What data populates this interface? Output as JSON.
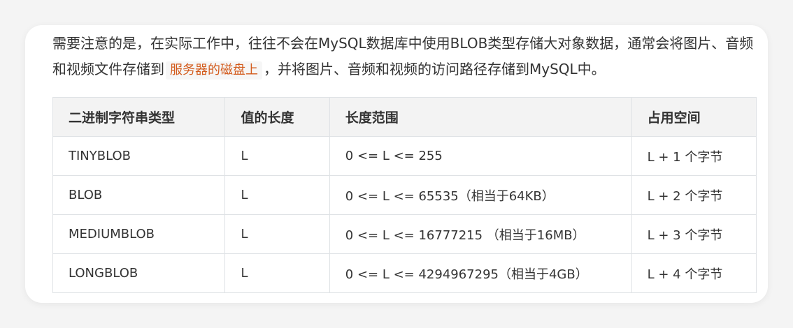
{
  "note": {
    "text_before": "需要注意的是，在实际工作中，往往不会在MySQL数据库中使用BLOB类型存储大对象数据，通常会将图片、音频和视频文件存储到",
    "highlight": "服务器的磁盘上",
    "text_after": "，并将图片、音频和视频的访问路径存储到MySQL中。"
  },
  "table": {
    "headers": [
      "二进制字符串类型",
      "值的长度",
      "长度范围",
      "占用空间"
    ],
    "rows": [
      [
        "TINYBLOB",
        "L",
        "0 <= L <= 255",
        "L + 1 个字节"
      ],
      [
        "BLOB",
        "L",
        "0 <= L <= 65535（相当于64KB）",
        "L + 2 个字节"
      ],
      [
        "MEDIUMBLOB",
        "L",
        "0 <= L <= 16777215 （相当于16MB）",
        "L + 3 个字节"
      ],
      [
        "LONGBLOB",
        "L",
        "0 <= L <= 4294967295（相当于4GB）",
        "L + 4 个字节"
      ]
    ]
  }
}
